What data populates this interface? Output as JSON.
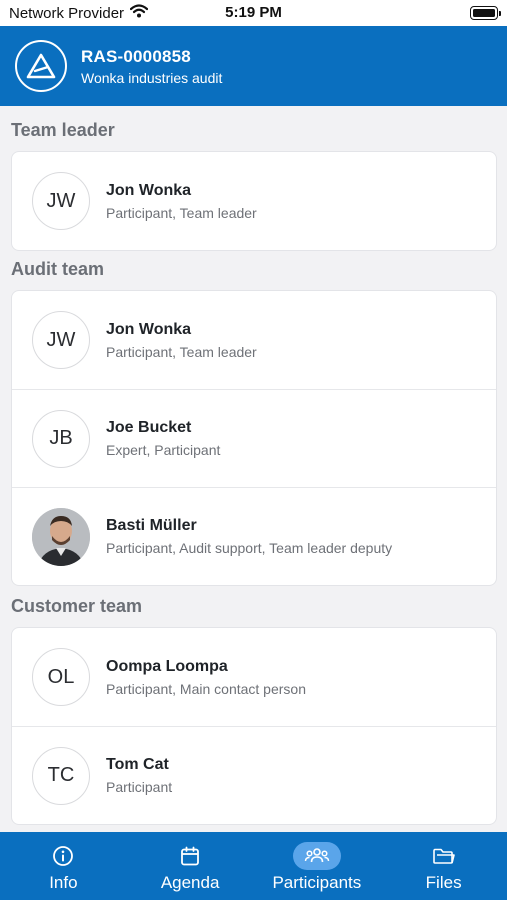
{
  "status_bar": {
    "carrier": "Network Provider",
    "time": "5:19 PM"
  },
  "header": {
    "title": "RAS-0000858",
    "subtitle": "Wonka industries audit",
    "logo_icon": "audit-logo-icon"
  },
  "sections": {
    "team_leader": {
      "title": "Team leader",
      "members": [
        {
          "initials": "JW",
          "name": "Jon Wonka",
          "roles": "Participant, Team leader"
        }
      ]
    },
    "audit_team": {
      "title": "Audit team",
      "members": [
        {
          "initials": "JW",
          "name": "Jon Wonka",
          "roles": "Participant, Team leader"
        },
        {
          "initials": "JB",
          "name": "Joe Bucket",
          "roles": "Expert, Participant"
        },
        {
          "initials": "",
          "name": "Basti Müller",
          "roles": "Participant, Audit support, Team leader deputy",
          "avatar": "photo"
        }
      ]
    },
    "customer_team": {
      "title": "Customer team",
      "members": [
        {
          "initials": "OL",
          "name": "Oompa Loompa",
          "roles": "Participant, Main contact person"
        },
        {
          "initials": "TC",
          "name": "Tom Cat",
          "roles": "Participant"
        }
      ]
    }
  },
  "tabs": [
    {
      "label": "Info",
      "icon": "info-icon",
      "active": false
    },
    {
      "label": "Agenda",
      "icon": "calendar-icon",
      "active": false
    },
    {
      "label": "Participants",
      "icon": "people-icon",
      "active": true
    },
    {
      "label": "Files",
      "icon": "folder-icon",
      "active": false
    }
  ],
  "colors": {
    "brand": "#0a6fbf",
    "active_tab_pill": "#5aa5ea",
    "background": "#f2f2f4"
  }
}
